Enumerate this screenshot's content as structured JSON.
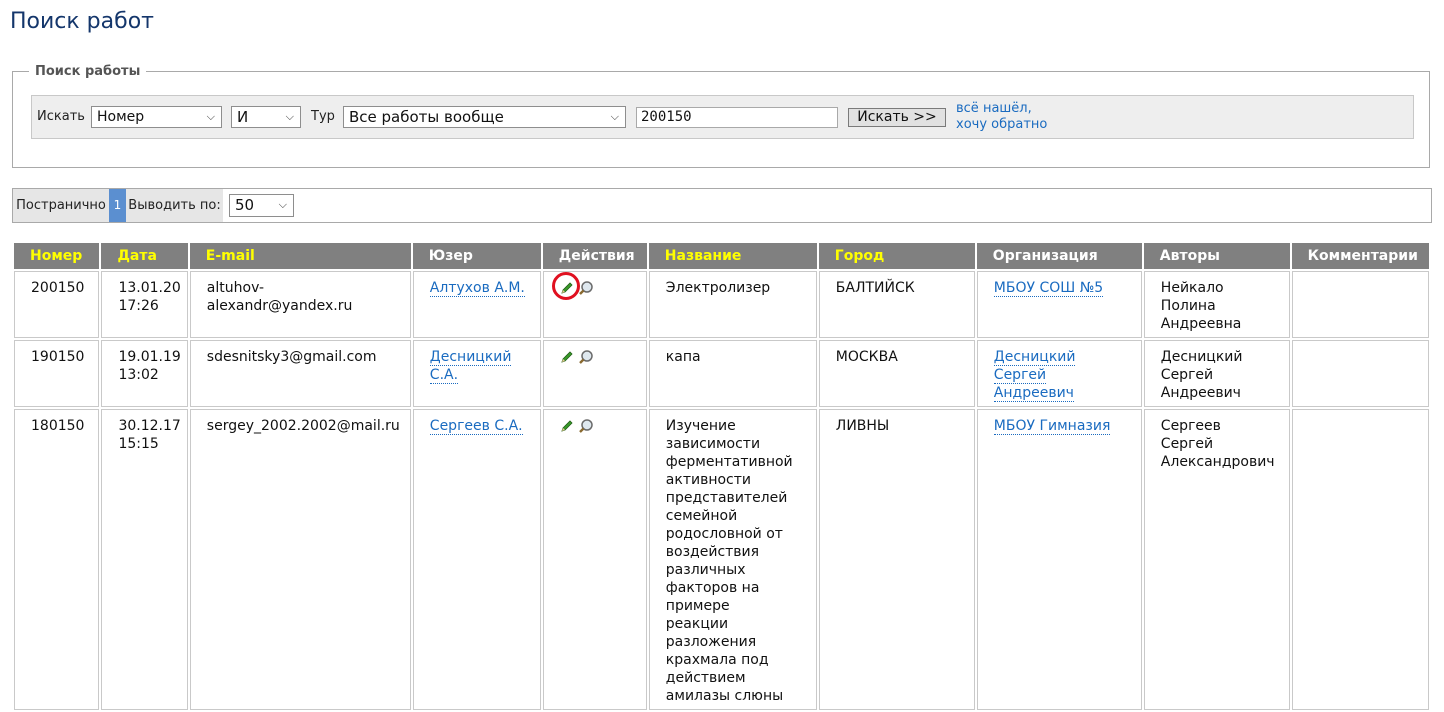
{
  "page": {
    "title": "Поиск работ"
  },
  "search": {
    "legend": "Поиск работы",
    "field_label": "Искать",
    "field_value": "Номер",
    "logic_value": "И",
    "tour_label": "Тур",
    "tour_value": "Все работы вообще",
    "query_value": "200150",
    "submit_label": "Искать >>",
    "back_link_line1": "всё нашёл,",
    "back_link_line2": "хочу обратно"
  },
  "pager": {
    "mode_label": "Постранично",
    "current_page": "1",
    "per_page_label": "Выводить по:",
    "per_page_value": "50"
  },
  "table": {
    "headers": [
      "Номер",
      "Дата",
      "E-mail",
      "Юзер",
      "Действия",
      "Название",
      "Город",
      "Организация",
      "Авторы",
      "Комментарии"
    ],
    "rows": [
      {
        "number": "200150",
        "date": "13.01.20 17:26",
        "email": "altuhov-alexandr@yandex.ru",
        "user": "Алтухов А.М.",
        "title": "Электролизер",
        "city": "БАЛТИЙСК",
        "org": "МБОУ СОШ №5",
        "authors": "Нейкало Полина Андреевна",
        "comments": ""
      },
      {
        "number": "190150",
        "date": "19.01.19 13:02",
        "email": "sdesnitsky3@gmail.com",
        "user": "Десницкий С.А.",
        "title": "капа",
        "city": "МОСКВА",
        "org": "Десницкий Сергей Андреевич",
        "authors": "Десницкий Сергей Андреевич",
        "comments": ""
      },
      {
        "number": "180150",
        "date": "30.12.17 15:15",
        "email": "sergey_2002.2002@mail.ru",
        "user": "Сергеев С.А.",
        "title": "Изучение зависимости ферментативной активности представителей семейной родословной от воздействия различных факторов на примере реакции разложения крахмала под действием амилазы слюны",
        "city": "ЛИВНЫ",
        "org": "МБОУ Гимназия",
        "authors": "Сергеев Сергей Александрович",
        "comments": ""
      }
    ]
  },
  "colors": {
    "header_bg": "#808080",
    "sortable_header_text": "#ffff00",
    "link": "#1a6bc0",
    "page_title": "#14366b",
    "highlight_circle": "#e01020"
  },
  "icons": {
    "edit": "pencil-icon",
    "view": "magnifier-icon"
  }
}
